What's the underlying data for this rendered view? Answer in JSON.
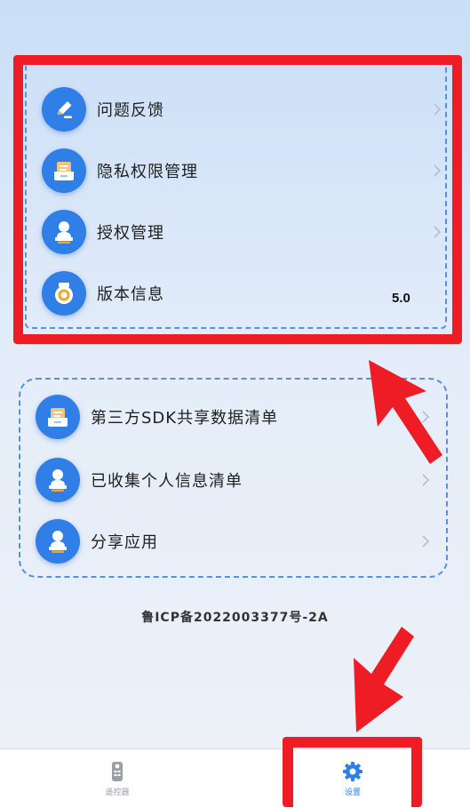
{
  "menu_group_1": {
    "items": [
      {
        "label": "问题反馈",
        "icon": "edit-pencil-icon"
      },
      {
        "label": "隐私权限管理",
        "icon": "document-tray-icon"
      },
      {
        "label": "授权管理",
        "icon": "user-stamp-icon"
      },
      {
        "label": "版本信息",
        "icon": "version-badge-icon",
        "value": "5.0"
      }
    ]
  },
  "menu_group_2": {
    "items": [
      {
        "label": "第三方SDK共享数据清单",
        "icon": "document-tray-icon"
      },
      {
        "label": "已收集个人信息清单",
        "icon": "user-stamp-icon"
      },
      {
        "label": "分享应用",
        "icon": "user-stamp-icon"
      }
    ]
  },
  "footer": {
    "icp": "鲁ICP备2022003377号-2A"
  },
  "tabbar": {
    "tabs": [
      {
        "label": "遥控器",
        "icon": "remote-control-icon",
        "active": false
      },
      {
        "label": "设置",
        "icon": "gear-icon",
        "active": true
      }
    ]
  },
  "colors": {
    "accent": "#2f7fe6",
    "annotation_red": "#ee1c25",
    "icon_orange": "#f5a623"
  }
}
